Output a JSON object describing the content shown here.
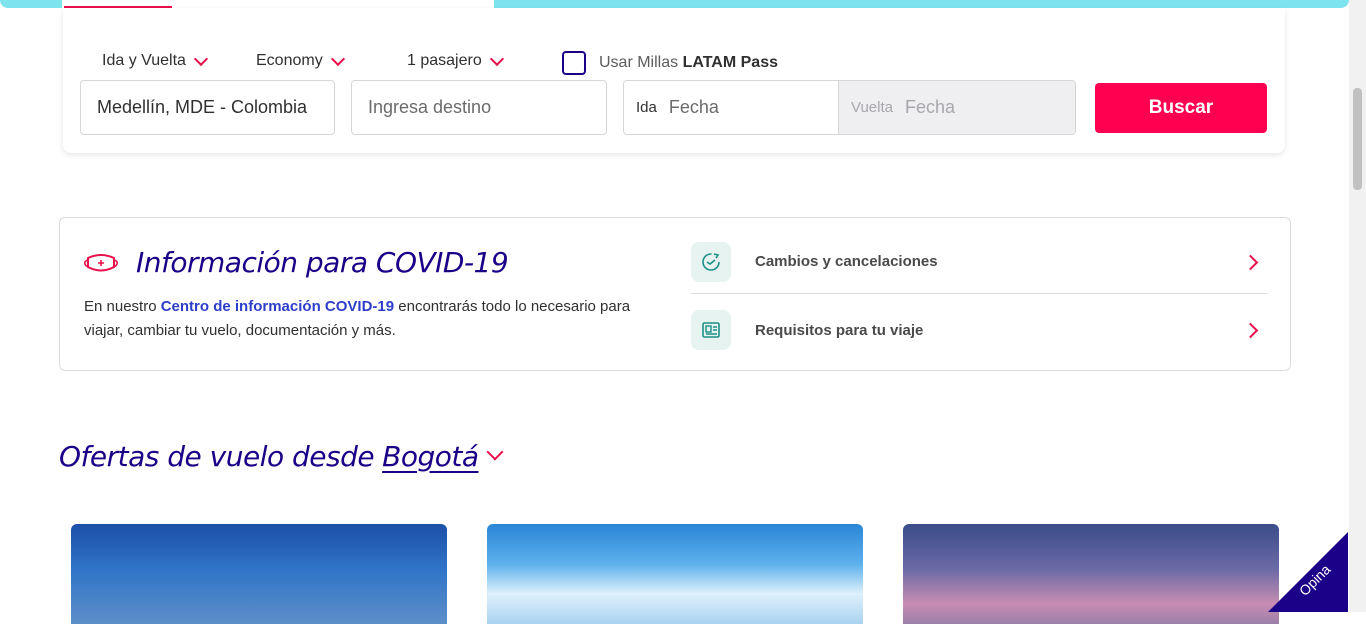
{
  "search": {
    "trip_type": "Ida y Vuelta",
    "cabin": "Economy",
    "passengers": "1 pasajero",
    "millas_prefix": "Usar Millas",
    "millas_brand": "LATAM Pass",
    "origin_value": "Medellín, MDE - Colombia",
    "destination_placeholder": "Ingresa destino",
    "ida_label": "Ida",
    "ida_placeholder": "Fecha",
    "vuelta_label": "Vuelta",
    "vuelta_placeholder": "Fecha",
    "search_button": "Buscar"
  },
  "covid": {
    "title": "Información para COVID-19",
    "text_before": "En nuestro ",
    "link_text": "Centro de información COVID-19",
    "text_after": " encontrarás todo lo necesario para viajar, cambiar tu vuelo, documentación y más.",
    "links": [
      {
        "label": "Cambios y cancelaciones",
        "icon": "refresh-icon"
      },
      {
        "label": "Requisitos para tu viaje",
        "icon": "document-icon"
      }
    ]
  },
  "offers": {
    "prefix": "Ofertas de vuelo desde",
    "city": "Bogotá"
  },
  "feedback_tab": "Opina",
  "colors": {
    "brand_red": "#e8114b",
    "brand_blue": "#1b0088",
    "accent_teal": "#7de4ee",
    "button": "#ff0050"
  }
}
